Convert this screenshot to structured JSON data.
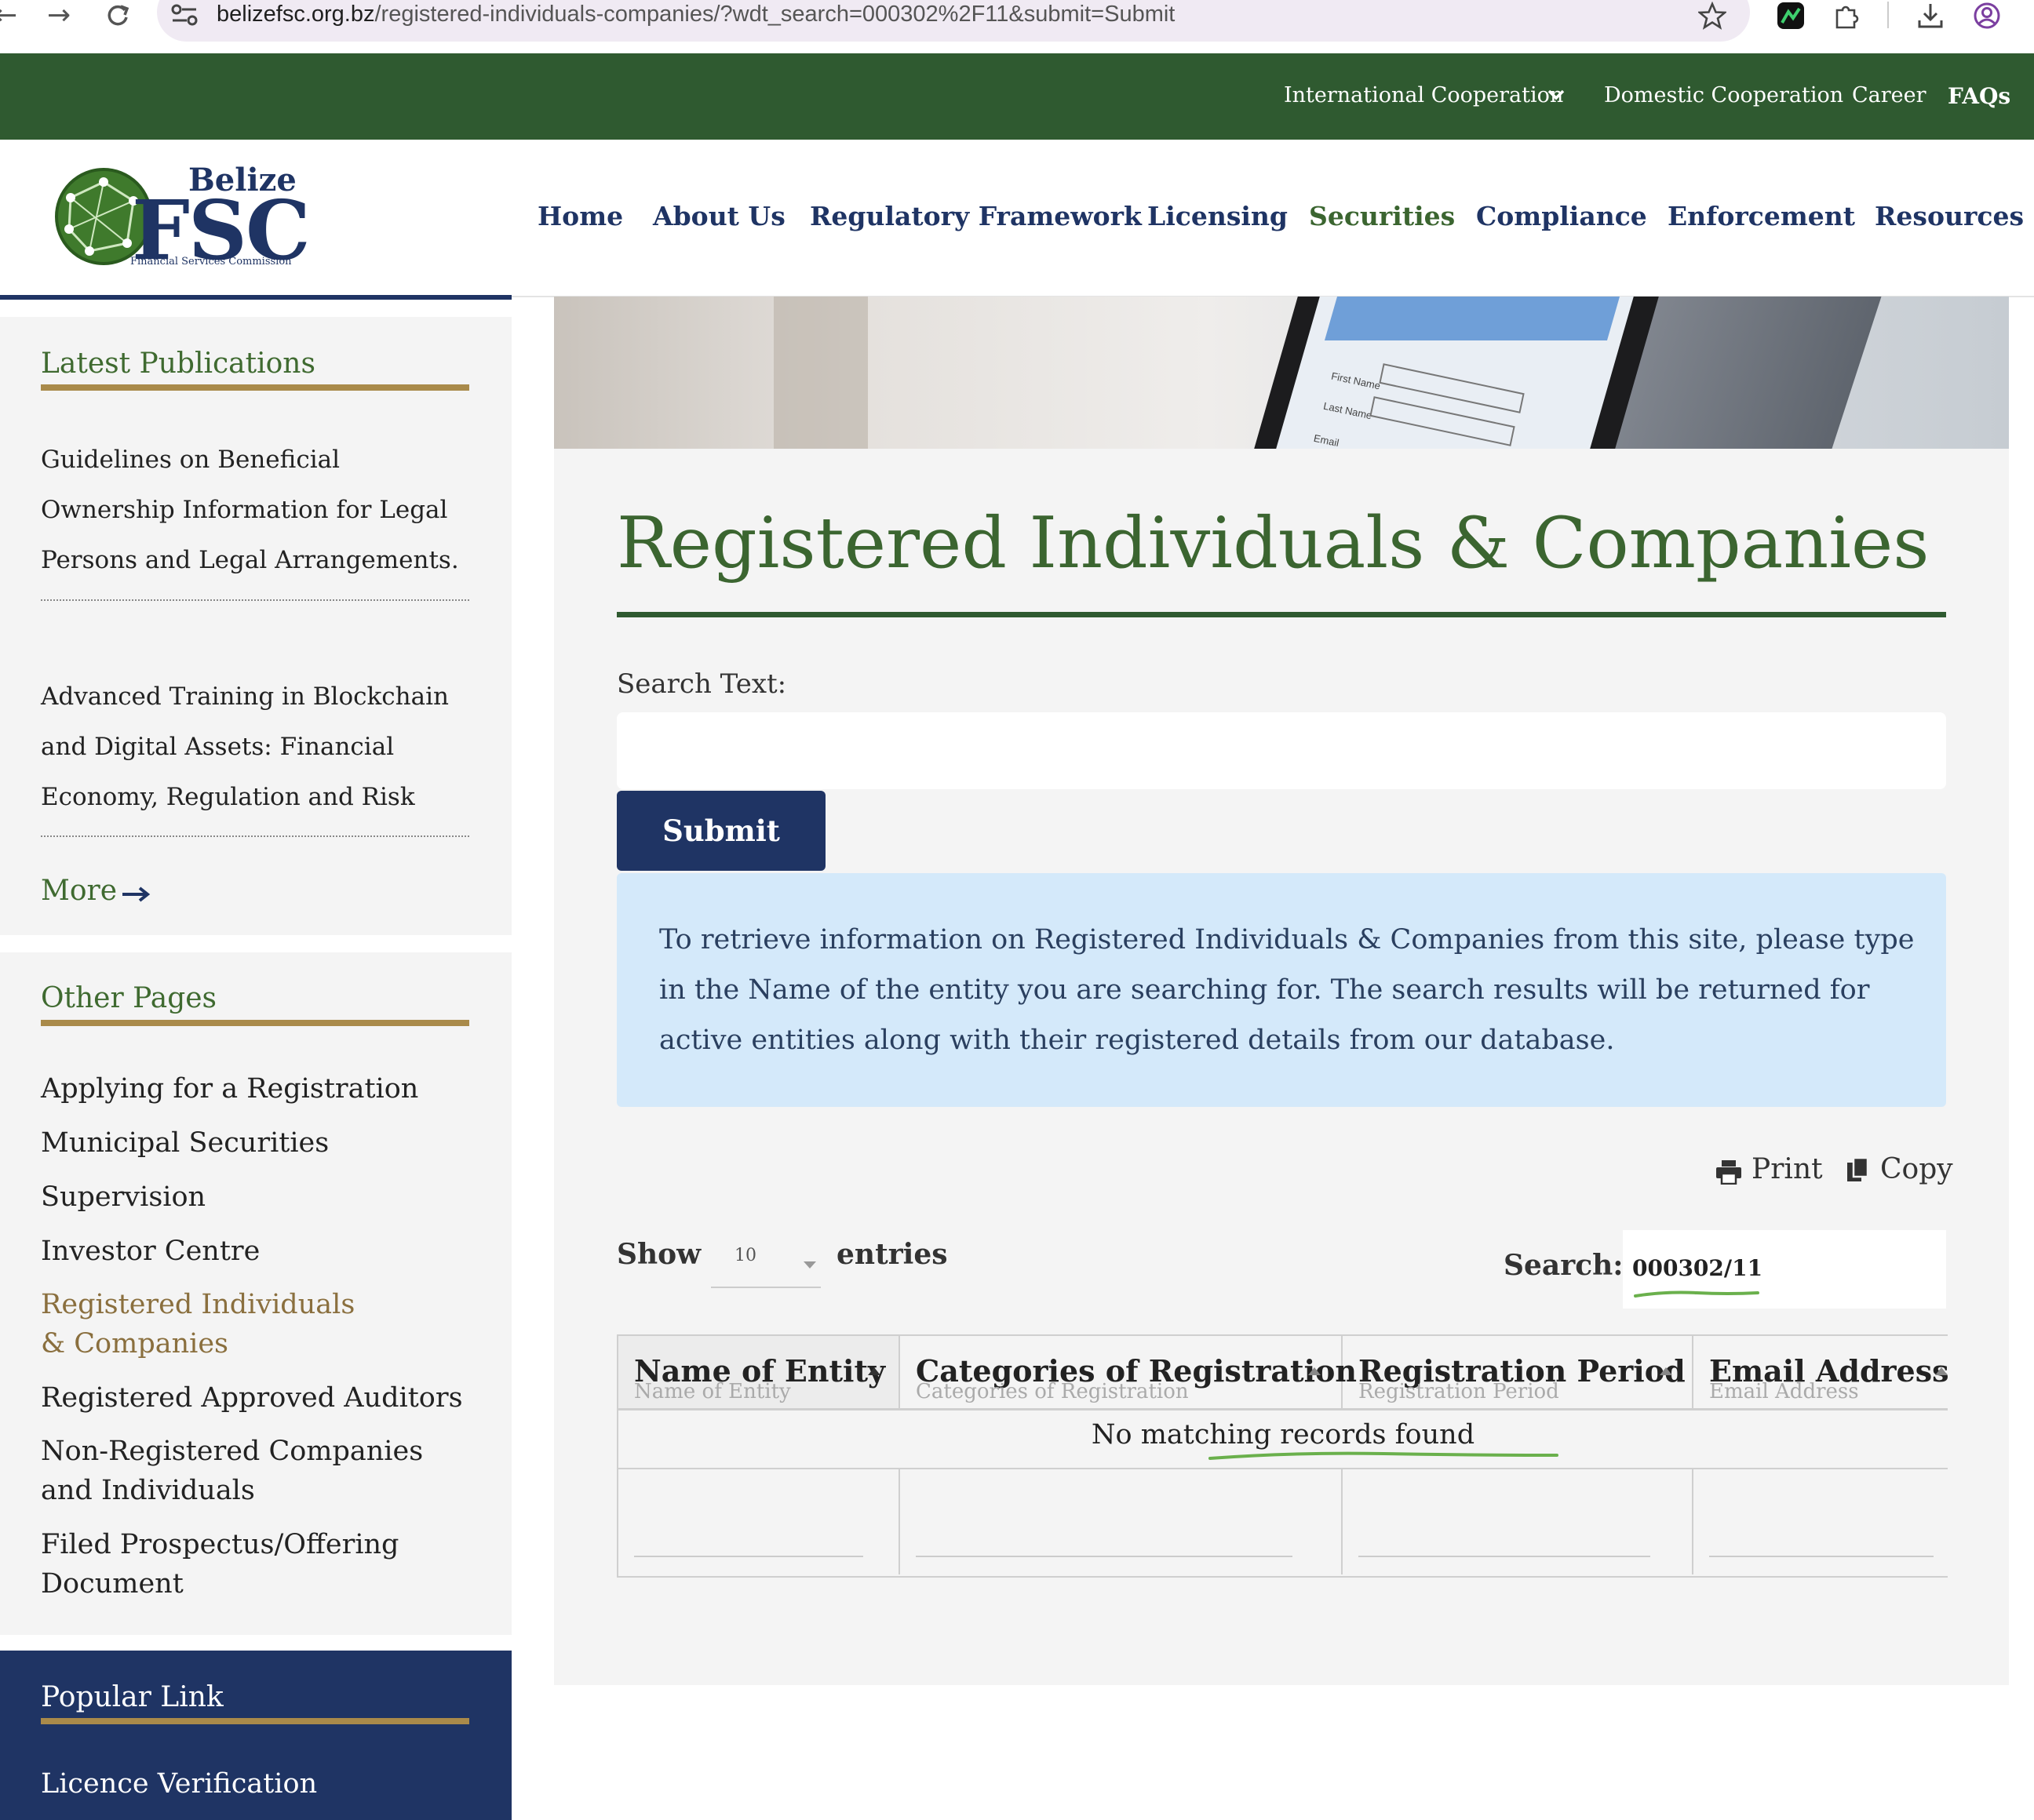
{
  "browser": {
    "url_host": "belizefsc.org.bz",
    "url_rest": "/registered-individuals-companies/?wdt_search=000302%2F11&submit=Submit"
  },
  "top_links": {
    "international": "International Cooperation",
    "domestic": "Domestic Cooperation",
    "career": "Career",
    "faqs": "FAQs"
  },
  "logo": {
    "word1": "Belize",
    "word2": "FSC",
    "tagline": "Financial Services Commission"
  },
  "main_nav": [
    "Home",
    "About Us",
    "Regulatory Framework",
    "Licensing",
    "Securities",
    "Compliance",
    "Enforcement",
    "Resources"
  ],
  "sidebar": {
    "latest_title": "Latest Publications",
    "publications": [
      "Guidelines on Beneficial Ownership Information for Legal Persons and Legal Arrangements.",
      "Advanced Training in Blockchain and Digital Assets: Financial Economy, Regulation and Risk"
    ],
    "more": "More",
    "other_title": "Other Pages",
    "other_pages": [
      "Applying for a Registration",
      "Municipal Securities",
      "Supervision",
      "Investor Centre",
      "Registered Individuals & Companies",
      "Registered Approved Auditors",
      "Non-Registered Companies and Individuals",
      "Filed Prospectus/Offering Document"
    ],
    "popular_title": "Popular Link",
    "popular_items": [
      "Licence Verification"
    ]
  },
  "hero": {
    "form_labels": [
      "First Name",
      "Last Name",
      "Email"
    ]
  },
  "content": {
    "title": "Registered Individuals & Companies",
    "search_label": "Search Text:",
    "search_value": "",
    "submit": "Submit",
    "info": "To retrieve information on Registered Individuals & Companies from this site, please type in the Name of the entity you are searching for. The search results will be returned for active entities along with their registered details from our database."
  },
  "table_tools": {
    "print": "Print",
    "copy": "Copy",
    "show": "Show",
    "entries_value": "10",
    "entries": "entries",
    "search_label": "Search:",
    "search_value": "000302/11"
  },
  "table": {
    "columns": [
      "Name of Entity",
      "Categories of Registration",
      "Registration Period",
      "Email Address"
    ],
    "empty_message": "No matching records found",
    "filter_placeholders": [
      "Name of Entity",
      "Categories of Registration",
      "Registration Period",
      "Email Address"
    ]
  },
  "colors": {
    "brand_green": "#2f5a30",
    "navy": "#1f3464",
    "gold": "#a98a4a",
    "active_link": "#8a6f3e",
    "info_bg": "#d4e9fa",
    "annotation_green": "#6ab04c"
  }
}
